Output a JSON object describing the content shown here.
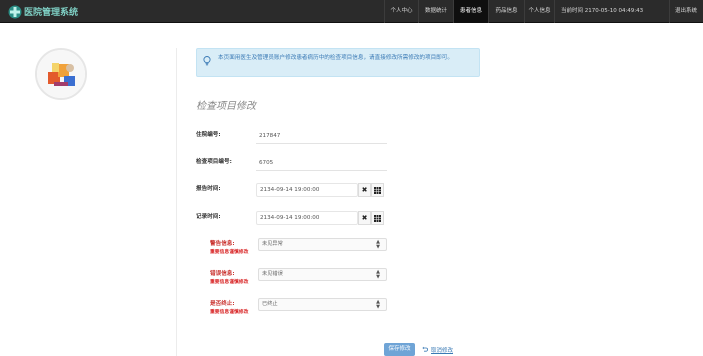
{
  "brand": {
    "title": "医院管理系统",
    "icon": "medical-cross-icon"
  },
  "nav": {
    "items": [
      {
        "label": "个人中心",
        "active": false
      },
      {
        "label": "数据统计",
        "active": false
      },
      {
        "label": "患者信息",
        "active": true
      },
      {
        "label": "药品信息",
        "active": false
      },
      {
        "label": "个人信息",
        "active": false
      }
    ],
    "time": "当前时间 2170-05-10 04:49:43",
    "logout": "退出系统"
  },
  "alert": {
    "icon": "lightbulb-icon",
    "text": "本页面用医生及管理员账户修改患者病历中的检查项目信息，请直接修改所需修改的项目即可。"
  },
  "page": {
    "title": "检查项目修改"
  },
  "form": {
    "hospital_no": {
      "label": "住院编号:",
      "value": "217847"
    },
    "exam_no": {
      "label": "检查项目编号:",
      "value": "6705"
    },
    "report_time": {
      "label": "报告时间:",
      "value": "2134-09-14 19:00:00"
    },
    "record_time": {
      "label": "记录时间:",
      "value": "2134-09-14 19:00:00"
    },
    "clear_icon": "clear-icon",
    "calendar_icon": "calendar-icon",
    "warning": {
      "label": "警告信息:",
      "note": "重要信息谨慎修改",
      "value": "未见异常"
    },
    "error": {
      "label": "错误信息:",
      "note": "重要信息谨慎修改",
      "value": "未见错误"
    },
    "terminated": {
      "label": "是否终止:",
      "note": "重要信息谨慎修改",
      "value": "已终止"
    }
  },
  "actions": {
    "save": "保存修改",
    "cancel": "取消修改",
    "cancel_icon": "undo-icon"
  },
  "colors": {
    "navbar": "#2b2b2b",
    "brand": "#7fd0c5",
    "alert_bg": "#d9edf7",
    "alert_text": "#3a7ab5",
    "danger": "#c9302c",
    "primary": "#6fa4d6"
  }
}
